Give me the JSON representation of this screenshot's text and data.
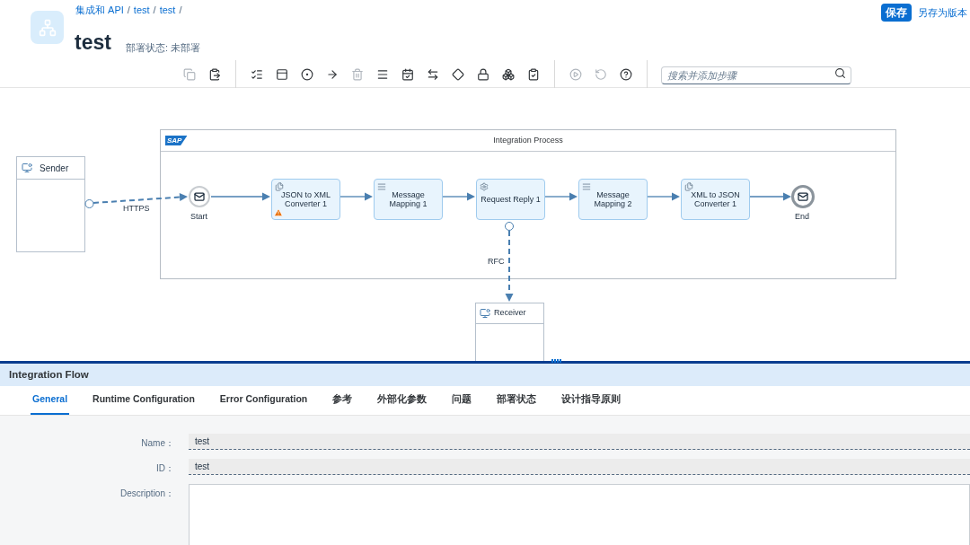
{
  "header": {
    "breadcrumbs": [
      "集成和 API",
      "test",
      "test"
    ],
    "breadcrumb_separator": "/",
    "title": "test",
    "status": "部署状态: 未部署",
    "save_button": "保存",
    "save_as_link": "另存为版本"
  },
  "toolbar": {
    "groups": [
      [
        {
          "kind": "copy",
          "disabled": true
        },
        {
          "kind": "paste",
          "disabled": false
        }
      ],
      [
        {
          "kind": "checks",
          "disabled": false
        },
        {
          "kind": "window",
          "disabled": false
        },
        {
          "kind": "target",
          "disabled": false
        },
        {
          "kind": "arrow",
          "disabled": false
        },
        {
          "kind": "delete",
          "disabled": true
        },
        {
          "kind": "menu",
          "disabled": false
        },
        {
          "kind": "calendar",
          "disabled": false
        },
        {
          "kind": "swap",
          "disabled": false
        },
        {
          "kind": "diamond",
          "disabled": false
        },
        {
          "kind": "lock",
          "disabled": false
        },
        {
          "kind": "cubes",
          "disabled": false
        },
        {
          "kind": "clipboard",
          "disabled": false
        }
      ],
      [
        {
          "kind": "play",
          "disabled": true
        },
        {
          "kind": "undo",
          "disabled": true
        },
        {
          "kind": "help",
          "disabled": false
        }
      ]
    ],
    "search": {
      "placeholder": "搜索并添加步骤"
    }
  },
  "diagram": {
    "sender": {
      "name": "Sender"
    },
    "receiver": {
      "name": "Receiver"
    },
    "pool": {
      "logo": "SAP",
      "title": "Integration Process"
    },
    "start": {
      "label": "Start"
    },
    "end": {
      "label": "End"
    },
    "steps": [
      {
        "kind": "converter",
        "label": "JSON to XML Converter 1",
        "warning": true
      },
      {
        "kind": "mapping",
        "label": "Message Mapping 1",
        "warning": false
      },
      {
        "kind": "request_reply",
        "label": "Request Reply 1",
        "warning": false
      },
      {
        "kind": "mapping",
        "label": "Message Mapping 2",
        "warning": false
      },
      {
        "kind": "converter",
        "label": "XML to JSON Converter 1",
        "warning": false
      }
    ],
    "sender_channel": "HTTPS",
    "receiver_channel": "RFC"
  },
  "panel": {
    "title": "Integration Flow",
    "tabs": [
      {
        "label": "General",
        "selected": true
      },
      {
        "label": "Runtime Configuration",
        "selected": false
      },
      {
        "label": "Error Configuration",
        "selected": false
      },
      {
        "label": "参考",
        "selected": false
      },
      {
        "label": "外部化参数",
        "selected": false
      },
      {
        "label": "问题",
        "selected": false
      },
      {
        "label": "部署状态",
        "selected": false
      },
      {
        "label": "设计指导原则",
        "selected": false
      }
    ],
    "fields": [
      {
        "kind": "input",
        "label": "Name：",
        "value": "test"
      },
      {
        "kind": "input",
        "label": "ID：",
        "value": "test"
      },
      {
        "kind": "textarea",
        "label": "Description："
      }
    ]
  }
}
